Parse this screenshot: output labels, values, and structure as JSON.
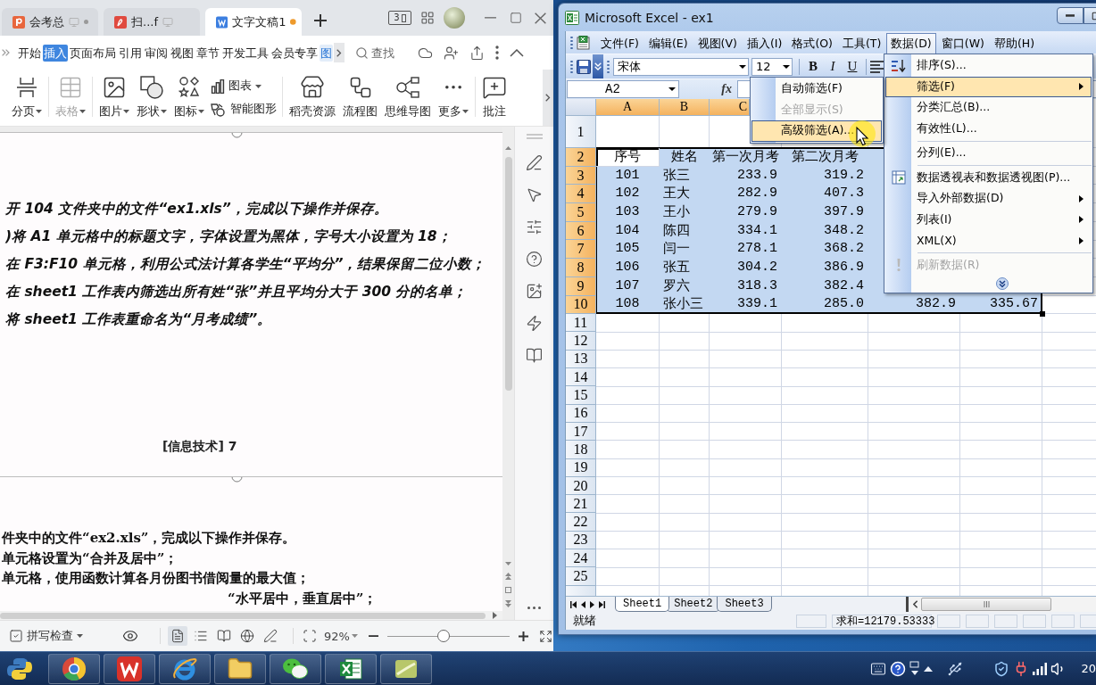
{
  "wps_window": {
    "tabs": [
      {
        "kind": "presentation",
        "title": "会考总",
        "selected": false,
        "unsaved": false
      },
      {
        "kind": "pdf",
        "title": "扫...f",
        "selected": false,
        "unsaved": false
      },
      {
        "kind": "writer",
        "title": "文字文稿1",
        "selected": true,
        "unsaved": true
      }
    ],
    "window_count": "3",
    "ribbon_tabs": [
      {
        "kind": "standard",
        "label": "开始",
        "selected": false
      },
      {
        "kind": "standard",
        "label": "插入",
        "selected": true
      },
      {
        "kind": "standard",
        "label": "页面布局",
        "selected": false
      },
      {
        "kind": "standard",
        "label": "引用",
        "selected": false
      },
      {
        "kind": "standard",
        "label": "审阅",
        "selected": false
      },
      {
        "kind": "standard",
        "label": "视图",
        "selected": false
      },
      {
        "kind": "standard",
        "label": "章节",
        "selected": false
      },
      {
        "kind": "standard",
        "label": "开发工具",
        "selected": false
      },
      {
        "kind": "standard",
        "label": "会员专享",
        "selected": false
      },
      {
        "kind": "contextual",
        "label": "图",
        "selected": false
      }
    ],
    "search": {
      "placeholder": "查找"
    },
    "ribbon_groups": [
      {
        "buttons": [
          {
            "kind": "large",
            "label": "分页",
            "menu": true,
            "disabled": false
          }
        ]
      },
      {
        "buttons": [
          {
            "kind": "large",
            "label": "表格",
            "menu": true,
            "disabled": true
          }
        ]
      },
      {
        "buttons": [
          {
            "kind": "large",
            "label": "图片",
            "menu": true,
            "disabled": false
          },
          {
            "kind": "large",
            "label": "形状",
            "menu": true,
            "disabled": false
          },
          {
            "kind": "large",
            "label": "图标",
            "menu": true,
            "disabled": false
          },
          {
            "kind": "small",
            "label": "图表",
            "menu": true,
            "disabled": false
          },
          {
            "kind": "small",
            "label": "智能图形",
            "menu": false,
            "disabled": false
          }
        ]
      },
      {
        "buttons": [
          {
            "kind": "large",
            "label": "稻壳资源",
            "menu": false,
            "disabled": false
          },
          {
            "kind": "large",
            "label": "流程图",
            "menu": false,
            "disabled": false
          },
          {
            "kind": "large",
            "label": "思维导图",
            "menu": false,
            "disabled": false
          },
          {
            "kind": "large",
            "label": "更多",
            "menu": true,
            "disabled": false
          }
        ]
      },
      {
        "buttons": [
          {
            "kind": "large",
            "label": "批注",
            "menu": false,
            "disabled": false
          }
        ]
      }
    ],
    "document": {
      "pages": [
        {
          "lines": [
            {
              "kind": "line",
              "text": "开 104 文件夹中的文件“ex1.xls”，完成以下操作并保存。"
            },
            {
              "kind": "line",
              "text": ")将 A1 单元格中的标题文字，字体设置为黑体，字号大小设置为 18；"
            },
            {
              "kind": "line",
              "text": "在 F3:F10 单元格，利用公式法计算各学生“平均分”，结果保留二位小数；"
            },
            {
              "kind": "line",
              "text": "在 sheet1 工作表内筛选出所有姓“张”并且平均分大于 300 分的名单；"
            },
            {
              "kind": "line",
              "text": "将 sheet1 工作表重命名为“月考成绩”。"
            }
          ],
          "footer": "[信息技术] 7"
        },
        {
          "lines": [
            {
              "kind": "line",
              "text": "件夹中的文件“ex2.xls”，完成以下操作并保存。"
            },
            {
              "kind": "line",
              "text": "单元格设置为“合并及居中”；"
            },
            {
              "kind": "line",
              "text": "单元格，使用函数计算各月份图书借阅量的最大值；"
            },
            {
              "kind": "fragment",
              "text": "“水平居中，垂直居中”；"
            }
          ]
        }
      ]
    },
    "status_bar": {
      "spell_check": "拼写检查",
      "views": [
        {
          "selected": true
        },
        {
          "selected": false
        },
        {
          "selected": false
        },
        {
          "selected": false
        },
        {
          "selected": false
        }
      ],
      "zoom": "92%",
      "zoom_slider": {
        "level": 0.46
      }
    }
  },
  "excel_window": {
    "title": "Microsoft Excel - ex1",
    "menu_bar": [
      {
        "label": "文件(F)",
        "selected": false
      },
      {
        "label": "编辑(E)",
        "selected": false
      },
      {
        "label": "视图(V)",
        "selected": false
      },
      {
        "label": "插入(I)",
        "selected": false
      },
      {
        "label": "格式(O)",
        "selected": false
      },
      {
        "label": "工具(T)",
        "selected": false
      },
      {
        "label": "数据(D)",
        "selected": true
      },
      {
        "label": "窗口(W)",
        "selected": false
      },
      {
        "label": "帮助(H)",
        "selected": false
      }
    ],
    "toolbar": {
      "font": "宋体",
      "font_size": "12",
      "format_buttons": [
        "B",
        "I",
        "U"
      ]
    },
    "name_box": "A2",
    "formula_label": "fx",
    "columns": [
      {
        "header": "A",
        "selected": true
      },
      {
        "header": "B",
        "selected": true
      },
      {
        "header": "C",
        "selected": true
      },
      {
        "selected": true
      },
      {
        "selected": true
      },
      {
        "selected": true
      }
    ],
    "rows": [
      {
        "number": "1",
        "kind": "title",
        "selected": false
      },
      {
        "number": "2",
        "kind": "header",
        "selected": true,
        "cells": [
          {
            "text": "序号",
            "active": true
          },
          {
            "text": "姓名",
            "active": false
          },
          {
            "text": "第一次月考",
            "active": false
          },
          {
            "text": "第二次月考",
            "active": false
          }
        ]
      },
      {
        "number": "3",
        "kind": "data",
        "selected": true,
        "cells": [
          {
            "text": "101",
            "active": false
          },
          {
            "text": "张三",
            "active": false
          },
          {
            "text": "233.9",
            "active": false
          },
          {
            "text": "319.2",
            "active": false
          }
        ]
      },
      {
        "number": "4",
        "kind": "data",
        "selected": true,
        "cells": [
          {
            "text": "102",
            "active": false
          },
          {
            "text": "王大",
            "active": false
          },
          {
            "text": "282.9",
            "active": false
          },
          {
            "text": "407.3",
            "active": false
          }
        ]
      },
      {
        "number": "5",
        "kind": "data",
        "selected": true,
        "cells": [
          {
            "text": "103",
            "active": false
          },
          {
            "text": "王小",
            "active": false
          },
          {
            "text": "279.9",
            "active": false
          },
          {
            "text": "397.9",
            "active": false
          }
        ]
      },
      {
        "number": "6",
        "kind": "data",
        "selected": true,
        "cells": [
          {
            "text": "104",
            "active": false
          },
          {
            "text": "陈四",
            "active": false
          },
          {
            "text": "334.1",
            "active": false
          },
          {
            "text": "348.2",
            "active": false
          }
        ]
      },
      {
        "number": "7",
        "kind": "data",
        "selected": true,
        "cells": [
          {
            "text": "105",
            "active": false
          },
          {
            "text": "闫一",
            "active": false
          },
          {
            "text": "278.1",
            "active": false
          },
          {
            "text": "368.2",
            "active": false
          }
        ]
      },
      {
        "number": "8",
        "kind": "data",
        "selected": true,
        "cells": [
          {
            "text": "106",
            "active": false
          },
          {
            "text": "张五",
            "active": false
          },
          {
            "text": "304.2",
            "active": false
          },
          {
            "text": "386.9",
            "active": false
          }
        ]
      },
      {
        "number": "9",
        "kind": "data",
        "selected": true,
        "cells": [
          {
            "text": "107",
            "active": false
          },
          {
            "text": "罗六",
            "active": false
          },
          {
            "text": "318.3",
            "active": false
          },
          {
            "text": "382.4",
            "active": false
          }
        ]
      },
      {
        "number": "10",
        "kind": "data",
        "selected": true,
        "cells": [
          {
            "text": "108",
            "active": false
          },
          {
            "text": "张小三",
            "active": false
          },
          {
            "text": "339.1",
            "active": false
          },
          {
            "text": "285.0",
            "active": false
          },
          {
            "text": "382.9",
            "active": false
          },
          {
            "text": "335.67",
            "active": false
          }
        ]
      },
      {
        "number": "11",
        "kind": "empty",
        "selected": false
      },
      {
        "number": "12",
        "kind": "empty",
        "selected": false
      },
      {
        "number": "13",
        "kind": "empty",
        "selected": false
      },
      {
        "number": "14",
        "kind": "empty",
        "selected": false
      },
      {
        "number": "15",
        "kind": "empty",
        "selected": false
      },
      {
        "number": "16",
        "kind": "empty",
        "selected": false
      },
      {
        "number": "17",
        "kind": "empty",
        "selected": false
      },
      {
        "number": "18",
        "kind": "empty",
        "selected": false
      },
      {
        "number": "19",
        "kind": "empty",
        "selected": false
      },
      {
        "number": "20",
        "kind": "empty",
        "selected": false
      },
      {
        "number": "21",
        "kind": "empty",
        "selected": false
      },
      {
        "number": "22",
        "kind": "empty",
        "selected": false
      },
      {
        "number": "23",
        "kind": "empty",
        "selected": false
      },
      {
        "number": "24",
        "kind": "empty",
        "selected": false
      },
      {
        "number": "25",
        "kind": "empty",
        "selected": false
      }
    ],
    "data_menu": [
      {
        "kind": "command",
        "label": "排序(S)...",
        "selected": false,
        "disabled": false,
        "submenu": false
      },
      {
        "kind": "command",
        "label": "筛选(F)",
        "selected": true,
        "disabled": false,
        "submenu": true
      },
      {
        "kind": "command",
        "label": "分类汇总(B)...",
        "selected": false,
        "disabled": false,
        "submenu": false
      },
      {
        "kind": "command",
        "label": "有效性(L)...",
        "selected": false,
        "disabled": false,
        "submenu": false
      },
      {
        "kind": "separator"
      },
      {
        "kind": "command",
        "label": "分列(E)...",
        "selected": false,
        "disabled": false,
        "submenu": false
      },
      {
        "kind": "separator"
      },
      {
        "kind": "command",
        "label": "数据透视表和数据透视图(P)...",
        "selected": false,
        "disabled": false,
        "submenu": false
      },
      {
        "kind": "command",
        "label": "导入外部数据(D)",
        "selected": false,
        "disabled": false,
        "submenu": true
      },
      {
        "kind": "command",
        "label": "列表(I)",
        "selected": false,
        "disabled": false,
        "submenu": true
      },
      {
        "kind": "command",
        "label": "XML(X)",
        "selected": false,
        "disabled": false,
        "submenu": true
      },
      {
        "kind": "separator"
      },
      {
        "kind": "command",
        "label": "刷新数据(R)",
        "selected": false,
        "disabled": true,
        "submenu": false
      },
      {
        "kind": "expand"
      }
    ],
    "filter_submenu": [
      {
        "label": "自动筛选(F)",
        "selected": false,
        "disabled": false
      },
      {
        "label": "全部显示(S)",
        "selected": false,
        "disabled": true
      },
      {
        "label": "高级筛选(A)...",
        "selected": true,
        "disabled": false
      }
    ],
    "sheet_tabs": [
      {
        "label": "Sheet1",
        "selected": true
      },
      {
        "label": "Sheet2",
        "selected": false
      },
      {
        "label": "Sheet3",
        "selected": false
      }
    ],
    "status_bar": {
      "text": "就绪",
      "sum": "求和=12179.53333"
    }
  },
  "taskbar": {
    "clock": "20"
  }
}
